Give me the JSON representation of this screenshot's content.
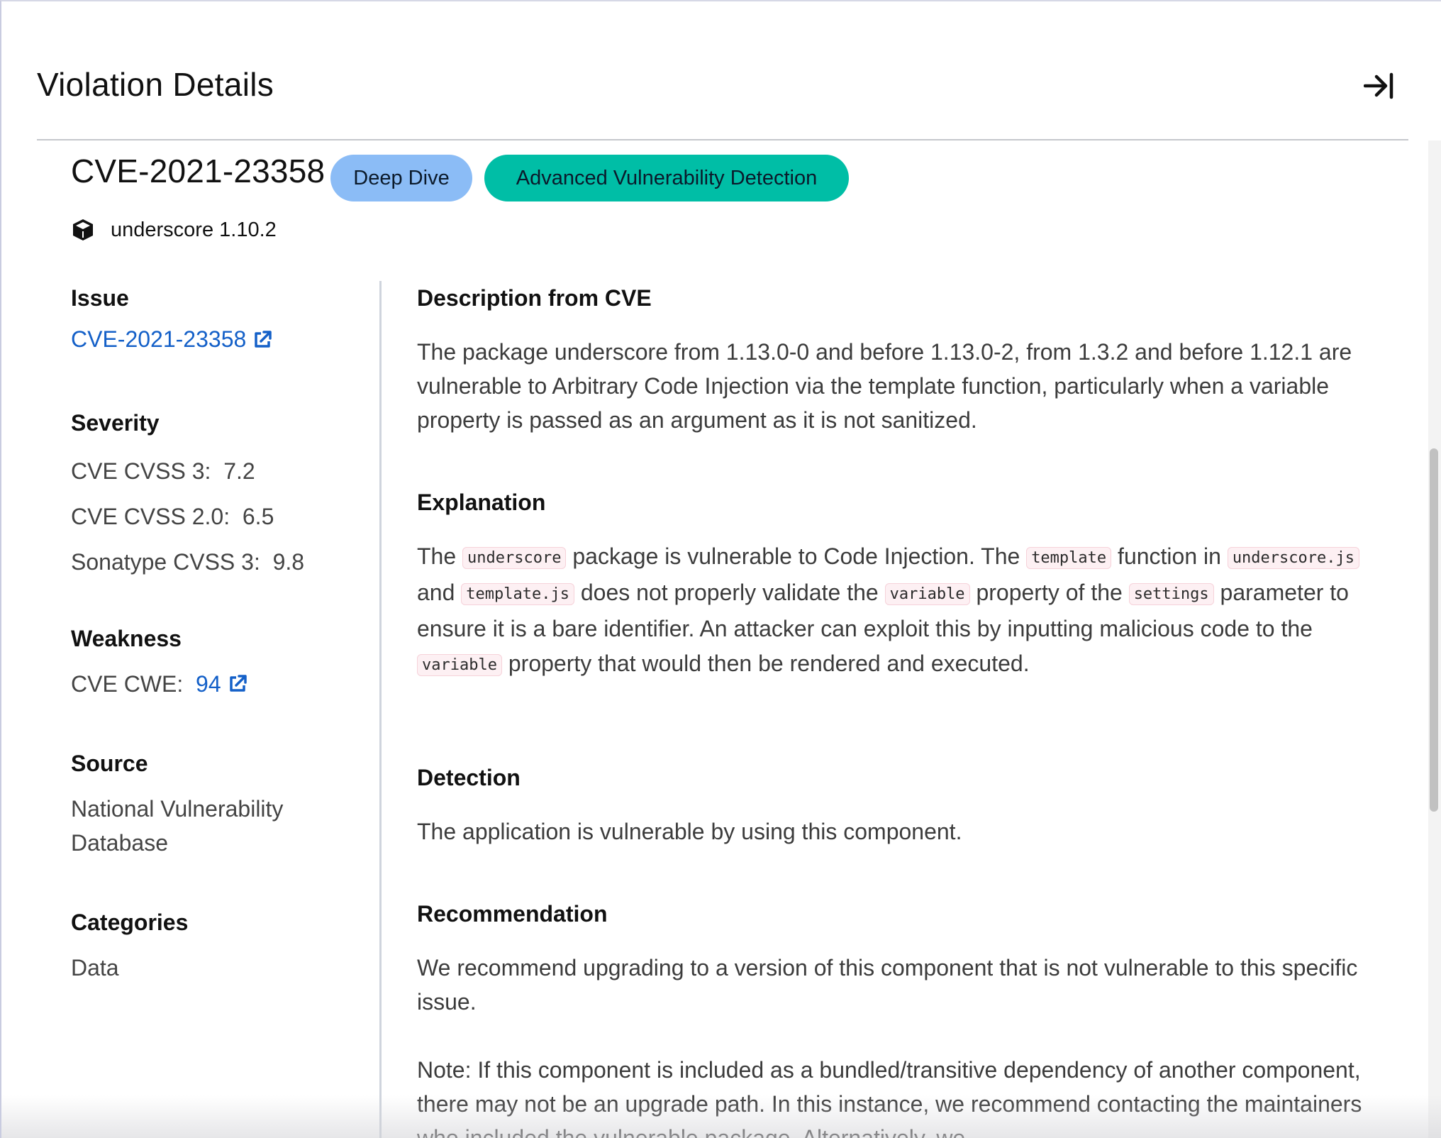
{
  "header": {
    "title": "Violation Details",
    "collapse_icon": "arrow-to-right-icon"
  },
  "violation": {
    "cve_id": "CVE-2021-23358",
    "badges": [
      "Deep Dive",
      "Advanced Vulnerability Detection"
    ],
    "badge_colors": [
      "#8bbcf6",
      "#00bea6"
    ],
    "package_icon": "cube-icon",
    "package": "underscore 1.10.2"
  },
  "sidebar": {
    "issue": {
      "heading": "Issue",
      "link_text": "CVE-2021-23358"
    },
    "severity": {
      "heading": "Severity",
      "rows": [
        {
          "label": "CVE CVSS 3:",
          "value": "7.2"
        },
        {
          "label": "CVE CVSS 2.0:",
          "value": "6.5"
        },
        {
          "label": "Sonatype CVSS 3:",
          "value": "9.8"
        }
      ]
    },
    "weakness": {
      "heading": "Weakness",
      "label": "CVE CWE:",
      "link_text": "94"
    },
    "source": {
      "heading": "Source",
      "value": "National Vulnerability Database"
    },
    "categories": {
      "heading": "Categories",
      "value": "Data"
    }
  },
  "main": {
    "description": {
      "heading": "Description from CVE",
      "text": "The package underscore from 1.13.0-0 and before 1.13.0-2, from 1.3.2 and before 1.12.1 are vulnerable to Arbitrary Code Injection via the template function, particularly when a variable property is passed as an argument as it is not sanitized."
    },
    "explanation": {
      "heading": "Explanation",
      "parts": [
        {
          "t": "The "
        },
        {
          "code": "underscore"
        },
        {
          "t": " package is vulnerable to Code Injection. The "
        },
        {
          "code": "template"
        },
        {
          "t": " function in "
        },
        {
          "code": "underscore.js"
        },
        {
          "t": " and "
        },
        {
          "code": "template.js"
        },
        {
          "t": " does not properly validate the "
        },
        {
          "code": "variable"
        },
        {
          "t": " property of the "
        },
        {
          "code": "settings"
        },
        {
          "t": " parameter to ensure it is a bare identifier. An attacker can exploit this by inputting malicious code to the "
        },
        {
          "code": "variable"
        },
        {
          "t": " property that would then be rendered and executed."
        }
      ]
    },
    "detection": {
      "heading": "Detection",
      "text": "The application is vulnerable by using this component."
    },
    "recommendation": {
      "heading": "Recommendation",
      "text": "We recommend upgrading to a version of this component that is not vulnerable to this specific issue.",
      "note": "Note: If this component is included as a bundled/transitive dependency of another component, there may not be an upgrade path. In this instance, we recommend contacting the maintainers who included the vulnerable package. Alternatively, we"
    }
  }
}
